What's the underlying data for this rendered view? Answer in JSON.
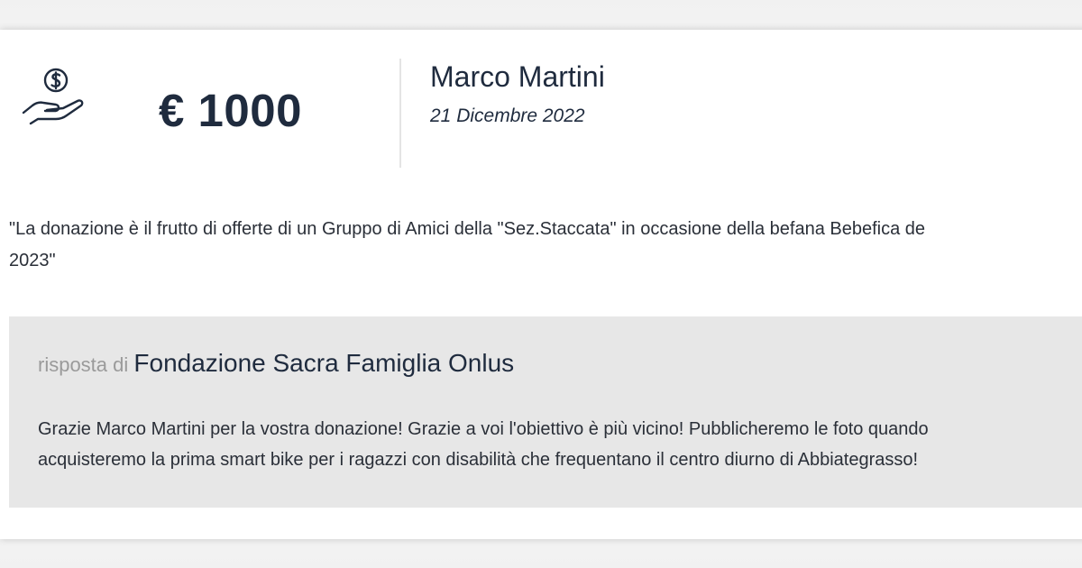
{
  "donation": {
    "amount": "€ 1000",
    "donor_name": "Marco Martini",
    "date": "21 Dicembre 2022",
    "icon": "hand-dollar-icon",
    "message": "\"La donazione è il frutto di offerte di un Gruppo di Amici della \"Sez.Staccata\" in occasione della befana Bebefica de\n2023\""
  },
  "reply": {
    "prefix": "risposta di",
    "organization": "Fondazione Sacra Famiglia Onlus",
    "text": "Grazie Marco Martini per la vostra donazione! Grazie a voi l'obiettivo è più vicino! Pubblicheremo le foto quando\nacquisteremo la prima smart bike per i ragazzi con disabilità che frequentano il centro diurno di Abbiategrasso!"
  },
  "colors": {
    "text_dark": "#1f2b3e",
    "reply_background": "#e7e7e7",
    "muted": "#9a9a9a"
  }
}
